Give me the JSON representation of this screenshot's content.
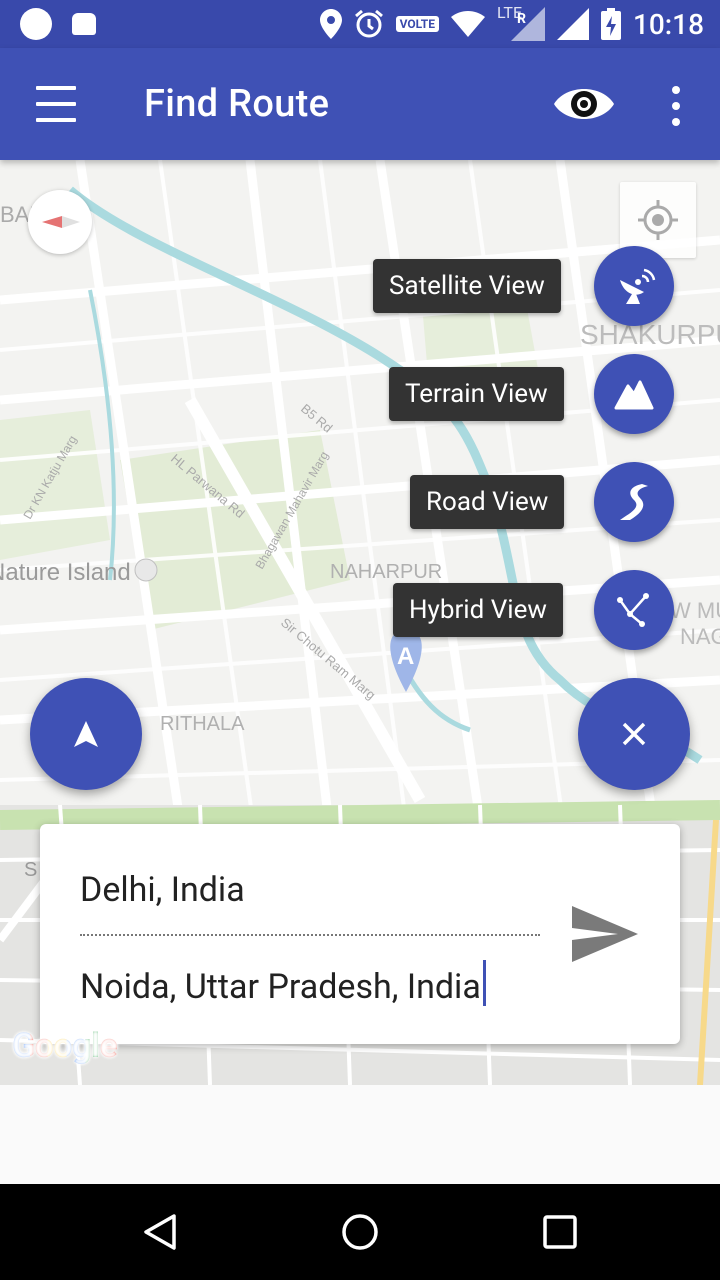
{
  "status_bar": {
    "time": "10:18",
    "network": "LTE",
    "volte": "VOLTE",
    "roaming": "R"
  },
  "toolbar": {
    "title": "Find Route"
  },
  "map": {
    "labels": {
      "badli": "BADLI",
      "shakurpur": "SHAKURPUR",
      "naharpur": "NAHARPUR",
      "nature_island": "Nature Island",
      "rithala": "RITHALA",
      "road_b5": "B5 Rd",
      "road_hl_parwana": "HL Parwana Rd",
      "road_katju": "Dr KN Katju Marg",
      "road_mahavir": "Bhagawan Mahavir Marg",
      "road_chotu_ram": "Sir Chotu Ram Marg",
      "marker": "A",
      "w_mu": "W MU",
      "nag": "NAG",
      "s": "S"
    },
    "attribution": "Google"
  },
  "map_type_menu": [
    {
      "label": "Satellite View",
      "icon": "satellite-icon"
    },
    {
      "label": "Terrain View",
      "icon": "terrain-icon"
    },
    {
      "label": "Road View",
      "icon": "road-icon"
    },
    {
      "label": "Hybrid View",
      "icon": "hybrid-icon"
    }
  ],
  "route_card": {
    "origin": "Delhi, India",
    "destination": "Noida, Uttar Pradesh, India"
  },
  "colors": {
    "primary": "#3f51b5",
    "primary_dark": "#3949ab",
    "chip": "#333333"
  }
}
